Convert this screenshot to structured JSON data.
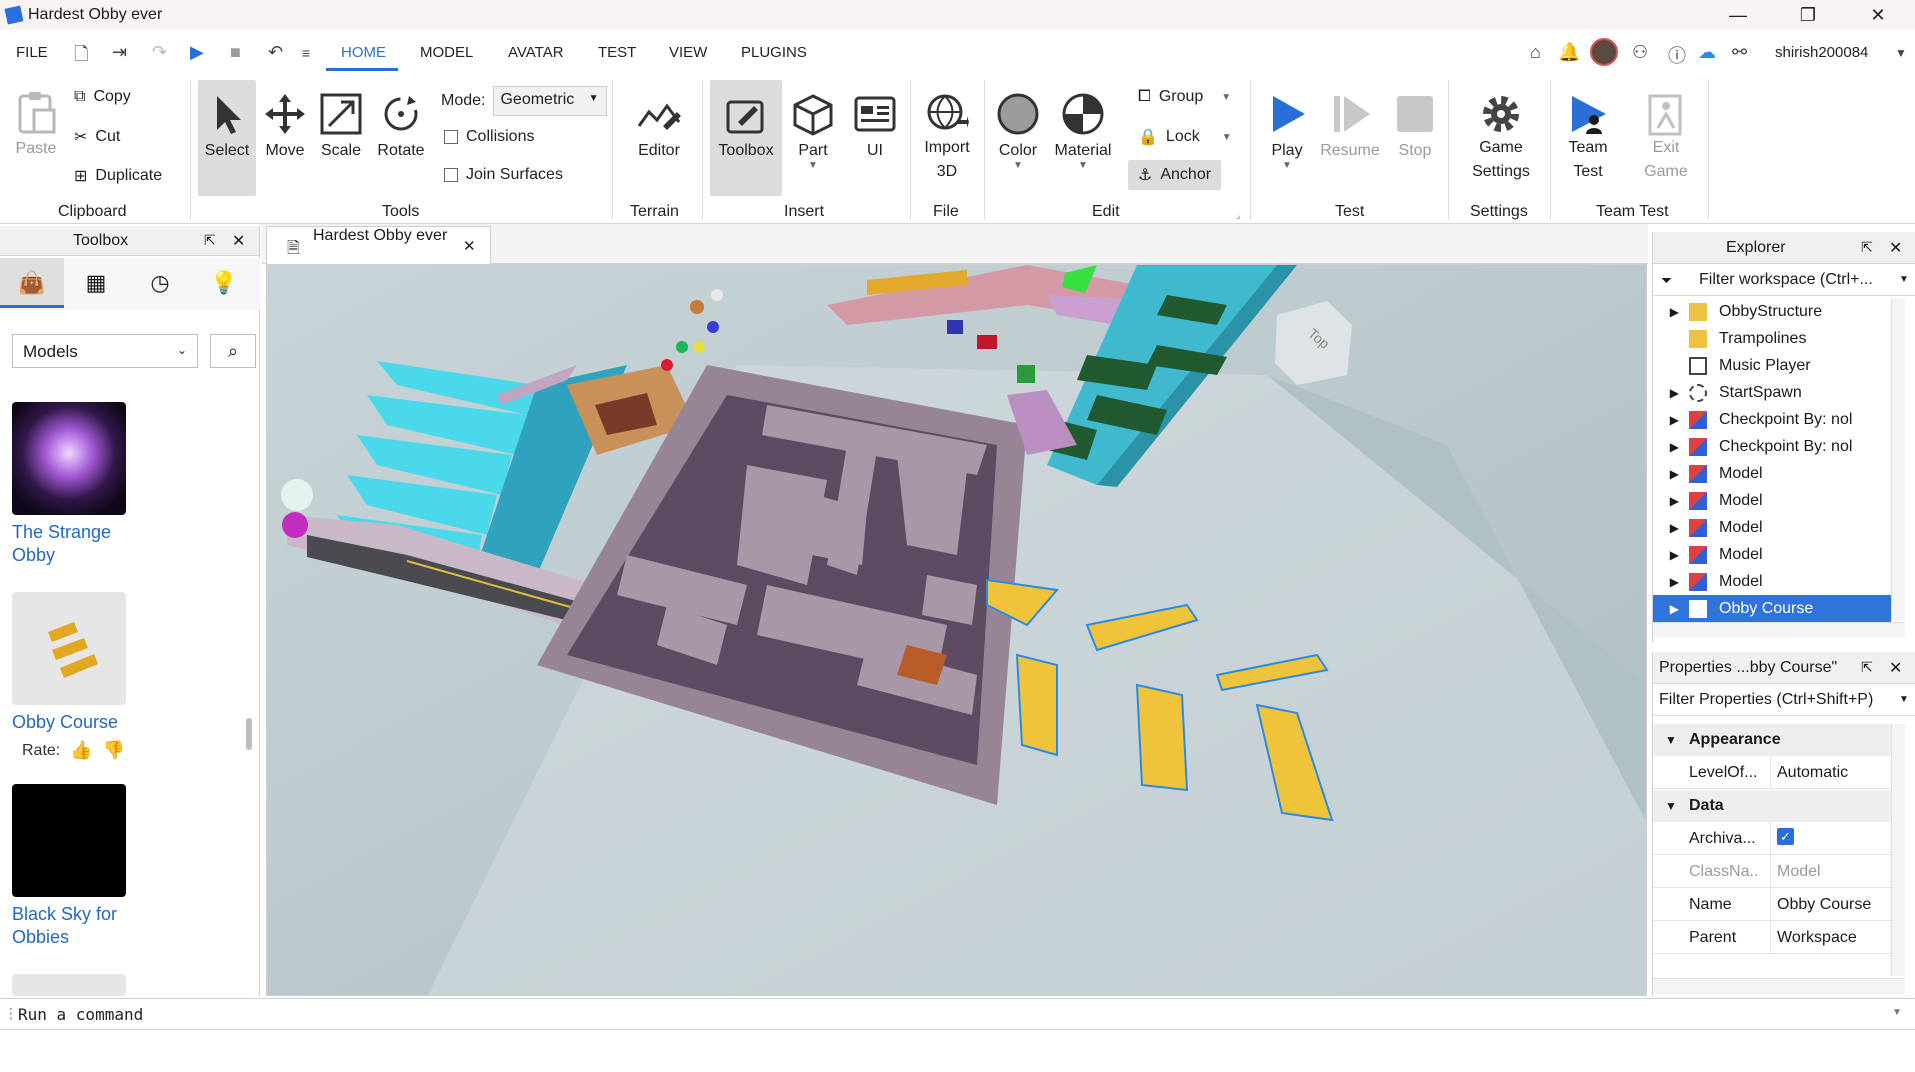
{
  "window": {
    "title": "Hardest Obby ever"
  },
  "menu": {
    "file": "FILE",
    "tabs": [
      "HOME",
      "MODEL",
      "AVATAR",
      "TEST",
      "VIEW",
      "PLUGINS"
    ],
    "username": "shirish200084"
  },
  "ribbon": {
    "clipboard": {
      "paste": "Paste",
      "copy": "Copy",
      "cut": "Cut",
      "duplicate": "Duplicate",
      "group": "Clipboard"
    },
    "tools": {
      "select": "Select",
      "move": "Move",
      "scale": "Scale",
      "rotate": "Rotate",
      "mode_label": "Mode:",
      "mode_value": "Geometric",
      "collisions": "Collisions",
      "join_surfaces": "Join Surfaces",
      "group": "Tools"
    },
    "terrain": {
      "editor": "Editor",
      "group": "Terrain"
    },
    "insert": {
      "toolbox": "Toolbox",
      "part": "Part",
      "ui": "UI",
      "group": "Insert"
    },
    "file": {
      "import_line1": "Import",
      "import_line2": "3D",
      "group": "File"
    },
    "edit": {
      "color": "Color",
      "material": "Material",
      "group_btn": "Group",
      "lock": "Lock",
      "anchor": "Anchor",
      "group": "Edit"
    },
    "test": {
      "play": "Play",
      "resume": "Resume",
      "stop": "Stop",
      "group": "Test"
    },
    "settings": {
      "game_line1": "Game",
      "game_line2": "Settings",
      "group": "Settings"
    },
    "team_test": {
      "team_line1": "Team",
      "team_line2": "Test",
      "exit_line1": "Exit",
      "exit_line2": "Game",
      "group": "Team Test"
    }
  },
  "toolbox": {
    "title": "Toolbox",
    "category": "Models",
    "items": [
      {
        "line1": "The Strange",
        "line2": "Obby"
      },
      {
        "line1": "Obby Course",
        "line2": ""
      },
      {
        "line1": "Black Sky for",
        "line2": "Obbies"
      }
    ],
    "rate_label": "Rate:"
  },
  "document": {
    "tab_title": "Hardest Obby ever"
  },
  "viewport": {
    "cube_label": "Top"
  },
  "explorer": {
    "title": "Explorer",
    "filter": "Filter workspace (Ctrl+...",
    "items": [
      {
        "label": "ObbyStructure",
        "icon": "folder-icon"
      },
      {
        "label": "Trampolines",
        "icon": "folder-icon"
      },
      {
        "label": "Music Player",
        "icon": "script-icon"
      },
      {
        "label": "StartSpawn",
        "icon": "spawn-icon"
      },
      {
        "label": "Checkpoint By: nol",
        "icon": "model-icon"
      },
      {
        "label": "Checkpoint By: nol",
        "icon": "model-icon"
      },
      {
        "label": "Model",
        "icon": "model-icon"
      },
      {
        "label": "Model",
        "icon": "model-icon"
      },
      {
        "label": "Model",
        "icon": "model-icon"
      },
      {
        "label": "Model",
        "icon": "model-icon"
      },
      {
        "label": "Model",
        "icon": "model-icon"
      },
      {
        "label": "Obby Course",
        "icon": "model-icon"
      }
    ]
  },
  "properties": {
    "title": "Properties ...bby Course\"",
    "filter": "Filter Properties (Ctrl+Shift+P)",
    "sections": [
      {
        "name": "Appearance",
        "rows": [
          {
            "key": "LevelOf...",
            "value": "Automatic"
          }
        ]
      },
      {
        "name": "Data",
        "rows": [
          {
            "key": "Archiva...",
            "value": ""
          },
          {
            "key": "ClassNa...",
            "value": "Model"
          },
          {
            "key": "Name",
            "value": "Obby Course"
          },
          {
            "key": "Parent",
            "value": "Workspace"
          }
        ]
      }
    ]
  },
  "command": {
    "placeholder": "Run a command"
  },
  "colors": {
    "accent": "#2a6fd8",
    "selection": "#2f73db",
    "link": "#2368c4"
  }
}
